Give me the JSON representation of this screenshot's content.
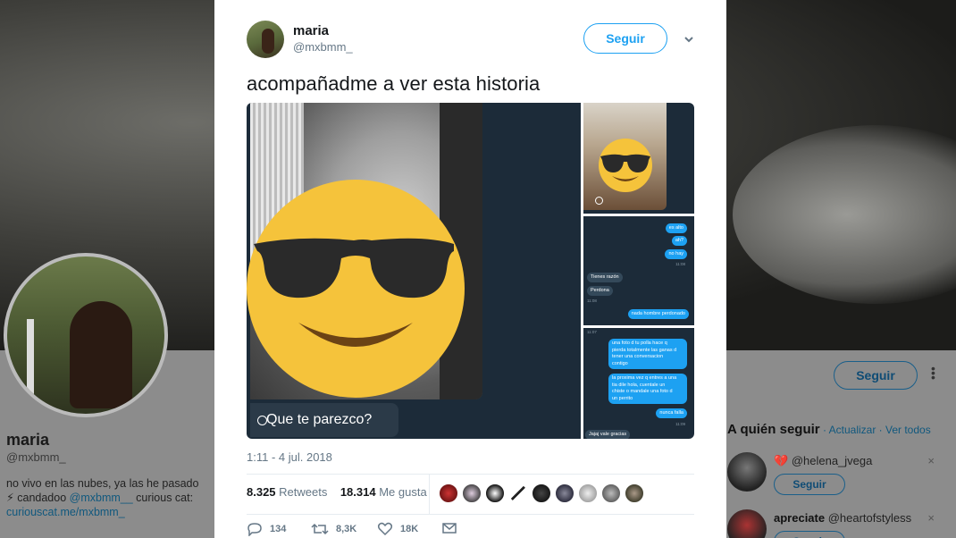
{
  "background_profile": {
    "name": "maria",
    "handle": "@mxbmm_",
    "bio_line1": "no vivo en las nubes, ya las he pasado",
    "bio_line2_prefix": "⚡ candadoo ",
    "bio_mention": "@mxbmm__",
    "bio_line2_suffix": " curious cat:",
    "bio_link": "curiouscat.me/mxbmm_",
    "follow_label": "Seguir"
  },
  "who_to_follow": {
    "title": "A quién seguir",
    "separator": " · ",
    "refresh": "Actualizar",
    "view_all": "Ver todos",
    "items": [
      {
        "emoji": "💔",
        "handle": "@helena_jvega",
        "follow": "Seguir",
        "close": "×"
      },
      {
        "name": "apreciate",
        "handle": "@heartofstyless",
        "follow": "Seguir",
        "close": "×"
      }
    ]
  },
  "tweet": {
    "author_name": "maria",
    "author_handle": "@mxbmm_",
    "follow_label": "Seguir",
    "text": "acompañadme a ver esta historia",
    "media": {
      "main_caption": "Que te parezco?",
      "chat_top": [
        "es alto",
        "ah?",
        "no hay"
      ],
      "chat_time_1": "11:08",
      "chat_them": [
        "Tienes razón",
        "Perdona"
      ],
      "chat_time_2": "11:08",
      "chat_me_2": "nada hombre perdonado",
      "chat_time_3": "11:07",
      "chat_bottom_me": [
        "una foto d tu polla hace q",
        "pierda totalmente las ganas d",
        "tener una conversacion",
        "contigo"
      ],
      "chat_bottom_me_2": [
        "la proxima vez q entres a una",
        "tia dile hola, cuentale un",
        "chiste o mandale una foto d",
        "un perrito"
      ],
      "chat_bottom_me_3": "nunca falla",
      "chat_time_4": "11:09",
      "chat_them_last": "Jajaj vale gracias"
    },
    "timestamp": "1:11 - 4 jul. 2018",
    "retweets_count": "8.325",
    "retweets_label": "Retweets",
    "likes_count": "18.314",
    "likes_label": "Me gusta",
    "actions": {
      "reply_count": "134",
      "retweet_count": "8,3K",
      "like_count": "18K"
    },
    "colors": {
      "accent": "#1da1f2",
      "secondary_text": "#657786",
      "emoji_yellow": "#f5c33b"
    }
  }
}
